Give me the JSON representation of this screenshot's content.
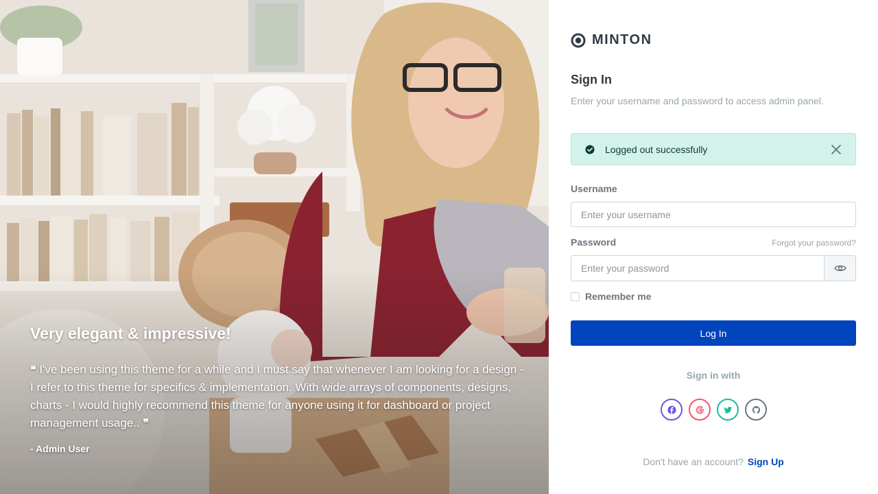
{
  "hero": {
    "heading": "Very elegant & impressive!",
    "quote_open": "❝",
    "quote": "I've been using this theme for a while and I must say that whenever I am looking for a design - I refer to this theme for specifics & implementation. With wide arrays of components, designs, charts - I would highly recommend this theme for anyone using it for dashboard or project management usage..",
    "quote_close": "❞",
    "author": "- Admin User"
  },
  "brand": {
    "name": "MINTON"
  },
  "form": {
    "title": "Sign In",
    "subtitle": "Enter your username and password to access admin panel.",
    "alert": {
      "message": "Logged out successfully",
      "status_color": "#d4f2ec"
    },
    "username": {
      "label": "Username",
      "placeholder": "Enter your username",
      "value": ""
    },
    "password": {
      "label": "Password",
      "placeholder": "Enter your password",
      "value": "",
      "forgot_label": "Forgot your password?"
    },
    "remember": {
      "label": "Remember me",
      "checked": false
    },
    "login_label": "Log In",
    "accent_color": "#0044be"
  },
  "social": {
    "heading": "Sign in with",
    "providers": [
      {
        "icon": "facebook-icon",
        "color": "#6658dd"
      },
      {
        "icon": "google-icon",
        "color": "#f1556c"
      },
      {
        "icon": "twitter-icon",
        "color": "#1abc9c"
      },
      {
        "icon": "github-icon",
        "color": "#6c757d"
      }
    ]
  },
  "footer": {
    "prompt": "Don't have an account?",
    "signup_label": "Sign Up"
  }
}
